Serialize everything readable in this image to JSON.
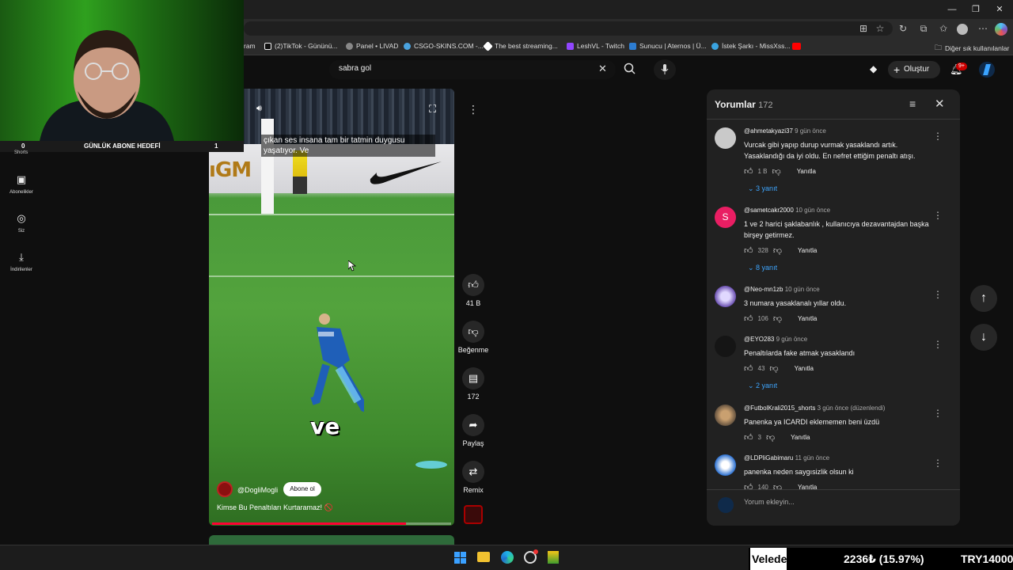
{
  "browser": {
    "window_controls": [
      "—",
      "❐",
      "✕"
    ],
    "bookmarks": [
      "ram",
      "(2)TikTok - Gününü...",
      "Panel • LIVAD",
      "CSGO-SKINS.COM -...",
      "The best streaming...",
      "LeshVL - Twitch",
      "Sunucu | Aternos | Ü...",
      "İstek Şarkı - MissXss..."
    ],
    "bookmarks_other": "Diğer sık kullanılanlar"
  },
  "youtube": {
    "search_value": "sabra gol",
    "create_label": "Oluştur",
    "notification_count": "9+"
  },
  "webcam_overlay": {
    "counter": "0",
    "goal_label": "GÜNLÜK ABONE HEDEFİ",
    "goal_value": "1",
    "shorts_label": "Shorts"
  },
  "left_nav": [
    {
      "label": "Abonelikler",
      "icon": "subscriptions-icon"
    },
    {
      "label": "Siz",
      "icon": "user-icon"
    },
    {
      "label": "İndirilenler",
      "icon": "download-icon"
    }
  ],
  "video": {
    "subtitle": "çıkan ses insana tam bir tatmin duygusu yaşatıyor. Ve",
    "caption_word": "ve",
    "channel": "@DogliMogli",
    "subscribe_label": "Abone ol",
    "title": "Kimse Bu Penaltıları Kurtaramaz! 🚫",
    "progress": 0.81
  },
  "actions": {
    "like_count": "41 B",
    "dislike_label": "Beğenme",
    "comment_count": "172",
    "share_label": "Paylaş",
    "remix_label": "Remix"
  },
  "comments_panel": {
    "title": "Yorumlar",
    "count": "172",
    "input_placeholder": "Yorum ekleyin...",
    "reply_label": "Yanıtla",
    "comments": [
      {
        "user": "@ahmetakyazi37",
        "time": "9 gün önce",
        "text": "Vurcak gibi yapıp durup vurmak yasaklandı artık. Yasaklandığı da iyi oldu. En nefret ettiğim penaltı atışı.",
        "likes": "1 B",
        "replies": "3 yanıt"
      },
      {
        "user": "@sametcakr2000",
        "time": "10 gün önce",
        "text": "1 ve 2 harici şaklabanlık , kullanıcıya dezavantajdan başka birşey getirmez.",
        "likes": "328",
        "replies": "8 yanıt",
        "avatar_letter": "S"
      },
      {
        "user": "@Neo-mn1zb",
        "time": "10 gün önce",
        "text": "3 numara yasaklanalı yıllar oldu.",
        "likes": "106",
        "replies": ""
      },
      {
        "user": "@EYO283",
        "time": "9 gün önce",
        "text": "Penaltılarda fake atmak yasaklandı",
        "likes": "43",
        "replies": "2 yanıt"
      },
      {
        "user": "@FutbolKrali2015_shorts",
        "time": "3 gün önce (düzenlendi)",
        "text": "Panenka ya ICARDI eklememen beni üzdü",
        "likes": "3",
        "replies": ""
      },
      {
        "user": "@LDPliGabimaru",
        "time": "11 gün önce",
        "text": "panenka neden saygısizlik olsun ki",
        "likes": "140",
        "replies": ""
      }
    ]
  },
  "ticker": {
    "name": "Velede Sadaka",
    "amount": "2236₺ (15.97%)",
    "goal": "TRY14000"
  },
  "colors": {
    "accent_red": "#ff0033",
    "link_blue": "#3ea6ff",
    "avatar_pink": "#e91e63"
  }
}
